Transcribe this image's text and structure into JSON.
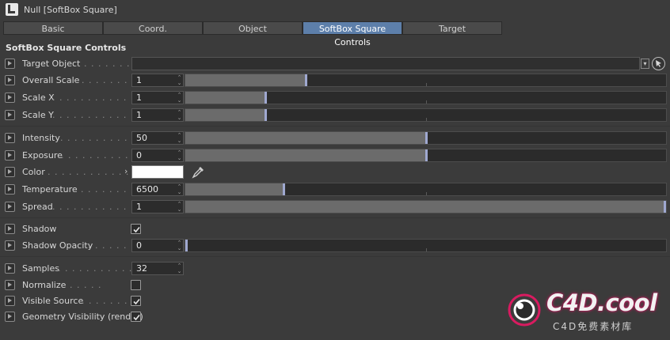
{
  "window": {
    "title": "Null [SoftBox Square]"
  },
  "tabs": [
    {
      "label": "Basic",
      "active": false
    },
    {
      "label": "Coord.",
      "active": false
    },
    {
      "label": "Object",
      "active": false
    },
    {
      "label": "SoftBox Square Controls",
      "active": true
    },
    {
      "label": "Target",
      "active": false
    }
  ],
  "section_title": "SoftBox Square Controls",
  "params": {
    "target_object": {
      "label": "Target Object",
      "value": ""
    },
    "overall_scale": {
      "label": "Overall Scale",
      "value": "1",
      "slider_fraction": 0.25
    },
    "scale_x": {
      "label": "Scale X",
      "value": "1",
      "slider_fraction": 0.167
    },
    "scale_y": {
      "label": "Scale Y",
      "value": "1",
      "slider_fraction": 0.167
    },
    "intensity": {
      "label": "Intensity",
      "value": "50",
      "slider_fraction": 0.5
    },
    "exposure": {
      "label": "Exposure",
      "value": "0",
      "slider_fraction": 0.5
    },
    "color": {
      "label": "Color",
      "value": "#ffffff"
    },
    "temperature": {
      "label": "Temperature",
      "value": "6500",
      "slider_fraction": 0.205
    },
    "spread": {
      "label": "Spread",
      "value": "1",
      "slider_fraction": 1.0
    },
    "shadow": {
      "label": "Shadow",
      "checked": true
    },
    "shadow_opacity": {
      "label": "Shadow Opacity",
      "value": "0",
      "slider_fraction": 0.0
    },
    "samples": {
      "label": "Samples",
      "value": "32"
    },
    "normalize": {
      "label": "Normalize",
      "checked": false
    },
    "visible_source": {
      "label": "Visible Source",
      "checked": true
    },
    "geometry_visibility": {
      "label": "Geometry Visibility (render)",
      "checked": true
    }
  },
  "watermark": {
    "text": "C4D.cool",
    "subtitle": "C4D免费素材库"
  },
  "colors": {
    "accent_tab": "#5d7faa",
    "slider_handle": "#9fa8d0",
    "watermark_glow": "#c2185b"
  }
}
